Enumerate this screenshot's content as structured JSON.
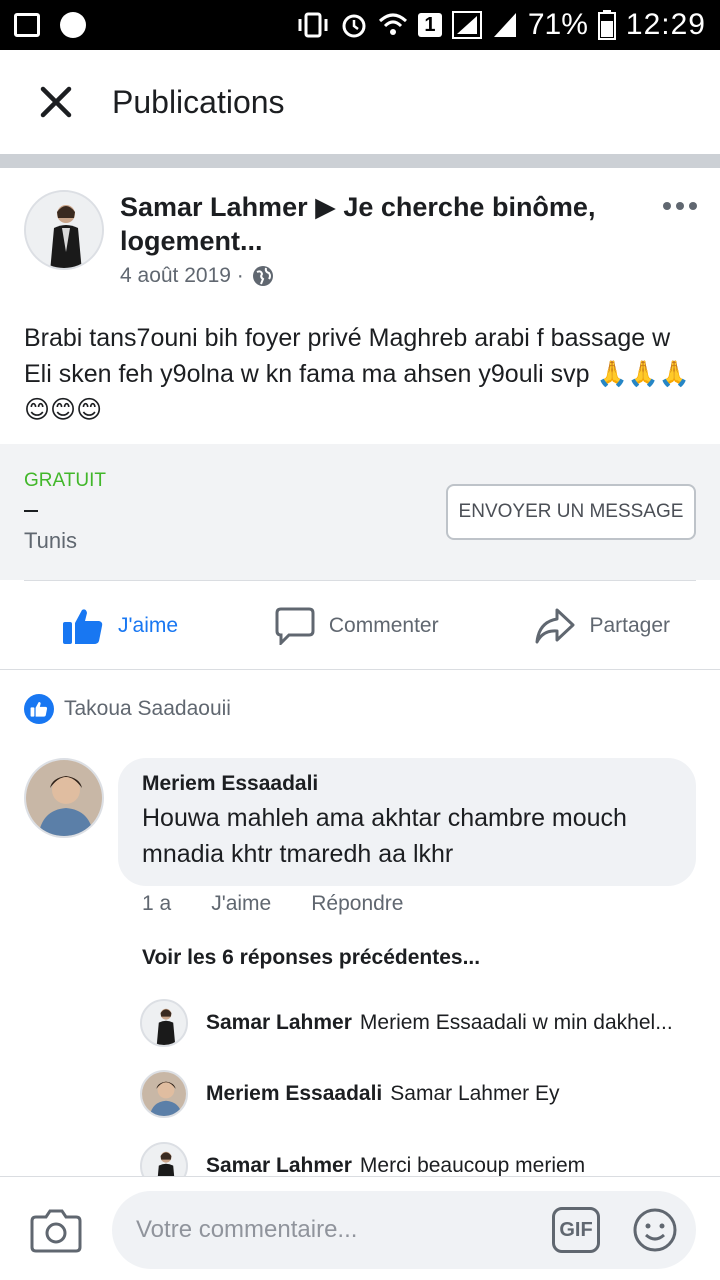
{
  "status_bar": {
    "battery": "71%",
    "time": "12:29",
    "sim": "1"
  },
  "header": {
    "title": "Publications"
  },
  "post": {
    "author_line": "Samar Lahmer ▶ Je cherche binôme, logement...",
    "date": "4 août 2019 ·",
    "text": "Brabi tans7ouni bih foyer privé Maghreb arabi f bassage w Eli sken feh y9olna w kn fama ma ahsen y9ouli  svp 🙏🙏🙏😊😊😊"
  },
  "marketplace": {
    "price": "GRATUIT",
    "location": "Tunis",
    "message_button": "ENVOYER UN MESSAGE"
  },
  "actions": {
    "like": "J'aime",
    "comment": "Commenter",
    "share": "Partager"
  },
  "likers": {
    "name": "Takoua Saadaouii"
  },
  "comment": {
    "author": "Meriem Essaadali",
    "text": "Houwa mahleh ama akhtar chambre mouch mnadia khtr tmaredh aa lkhr",
    "age": "1 a",
    "like": "J'aime",
    "reply": "Répondre"
  },
  "replies": {
    "view_previous": "Voir les 6 réponses précédentes...",
    "items": [
      {
        "author": "Samar Lahmer",
        "text": "Meriem Essaadali w min dakhel..."
      },
      {
        "author": "Meriem Essaadali",
        "text": "Samar Lahmer Ey"
      },
      {
        "author": "Samar Lahmer",
        "text": "Merci beaucoup meriem"
      }
    ]
  },
  "composer": {
    "placeholder": "Votre commentaire...",
    "gif_label": "GIF"
  },
  "colors": {
    "brand_blue": "#1877f2",
    "price_green": "#42b72a",
    "text_secondary": "#606770"
  }
}
